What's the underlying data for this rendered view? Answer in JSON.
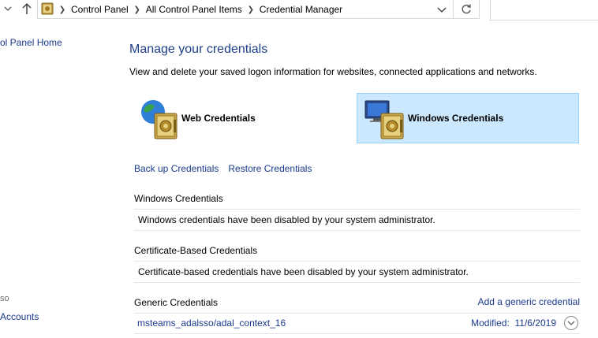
{
  "address_bar": {
    "breadcrumbs": [
      "Control Panel",
      "All Control Panel Items",
      "Credential Manager"
    ]
  },
  "left_pane": {
    "home_link": "ol Panel Home",
    "see_also_fragment": "so",
    "accounts_link": "Accounts"
  },
  "main": {
    "title": "Manage your credentials",
    "description": "View and delete your saved logon information for websites, connected applications and networks.",
    "tiles": {
      "web": "Web Credentials",
      "windows": "Windows Credentials"
    },
    "links": {
      "backup": "Back up Credentials",
      "restore": "Restore Credentials"
    },
    "sections": {
      "windows": {
        "title": "Windows Credentials",
        "message": "Windows credentials have been disabled by your system administrator."
      },
      "certificate": {
        "title": "Certificate-Based Credentials",
        "message": "Certificate-based credentials have been disabled by your system administrator."
      },
      "generic": {
        "title": "Generic Credentials",
        "add_link": "Add a generic credential",
        "items": [
          {
            "name": "msteams_adalsso/adal_context_16",
            "modified_label": "Modified:",
            "modified_date": "11/6/2019"
          }
        ]
      }
    }
  },
  "colors": {
    "link": "#1a3a8f",
    "title": "#1e3f88",
    "selected_tile_bg": "#cce8ff",
    "selected_tile_border": "#99d1ff"
  },
  "icons": {
    "nav_dropdown": "chevron-down-icon",
    "up": "arrow-up-icon",
    "control_panel": "control-panel-icon",
    "address_dropdown": "chevron-down-icon",
    "refresh": "refresh-icon",
    "web_tile": "globe-vault-icon",
    "windows_tile": "monitor-vault-icon",
    "expand": "circle-chevron-down-icon"
  }
}
